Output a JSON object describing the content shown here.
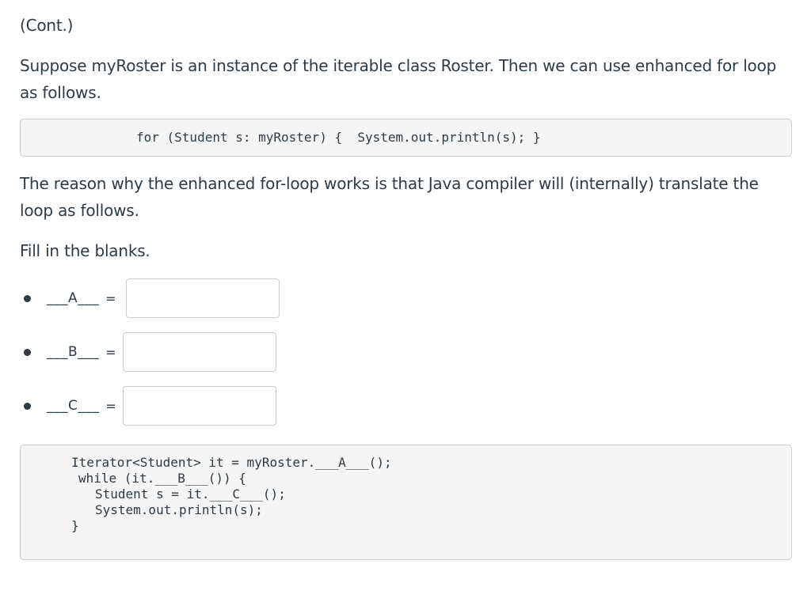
{
  "question": {
    "continuation_label": "(Cont.)",
    "intro_text": "Suppose myRoster is an instance of the iterable class  Roster. Then we can use enhanced for loop as follows.",
    "code_snippet": "for (Student s: myRoster) {  System.out.println(s); }",
    "reason_text": "The reason why the enhanced for-loop works  is that Java compiler will (internally) translate the loop as follows.",
    "instruction": "Fill in the blanks."
  },
  "blanks": [
    {
      "label": "___A___",
      "equals": "=",
      "value": ""
    },
    {
      "label": "___B___",
      "equals": "=",
      "value": ""
    },
    {
      "label": "___C___",
      "equals": "=",
      "value": ""
    }
  ],
  "translated_code": {
    "lines": [
      "Iterator<Student> it = myRoster.___A___();",
      "while (it.___B___()) {",
      "Student s = it.___C___();",
      "System.out.println(s);",
      "}"
    ]
  }
}
